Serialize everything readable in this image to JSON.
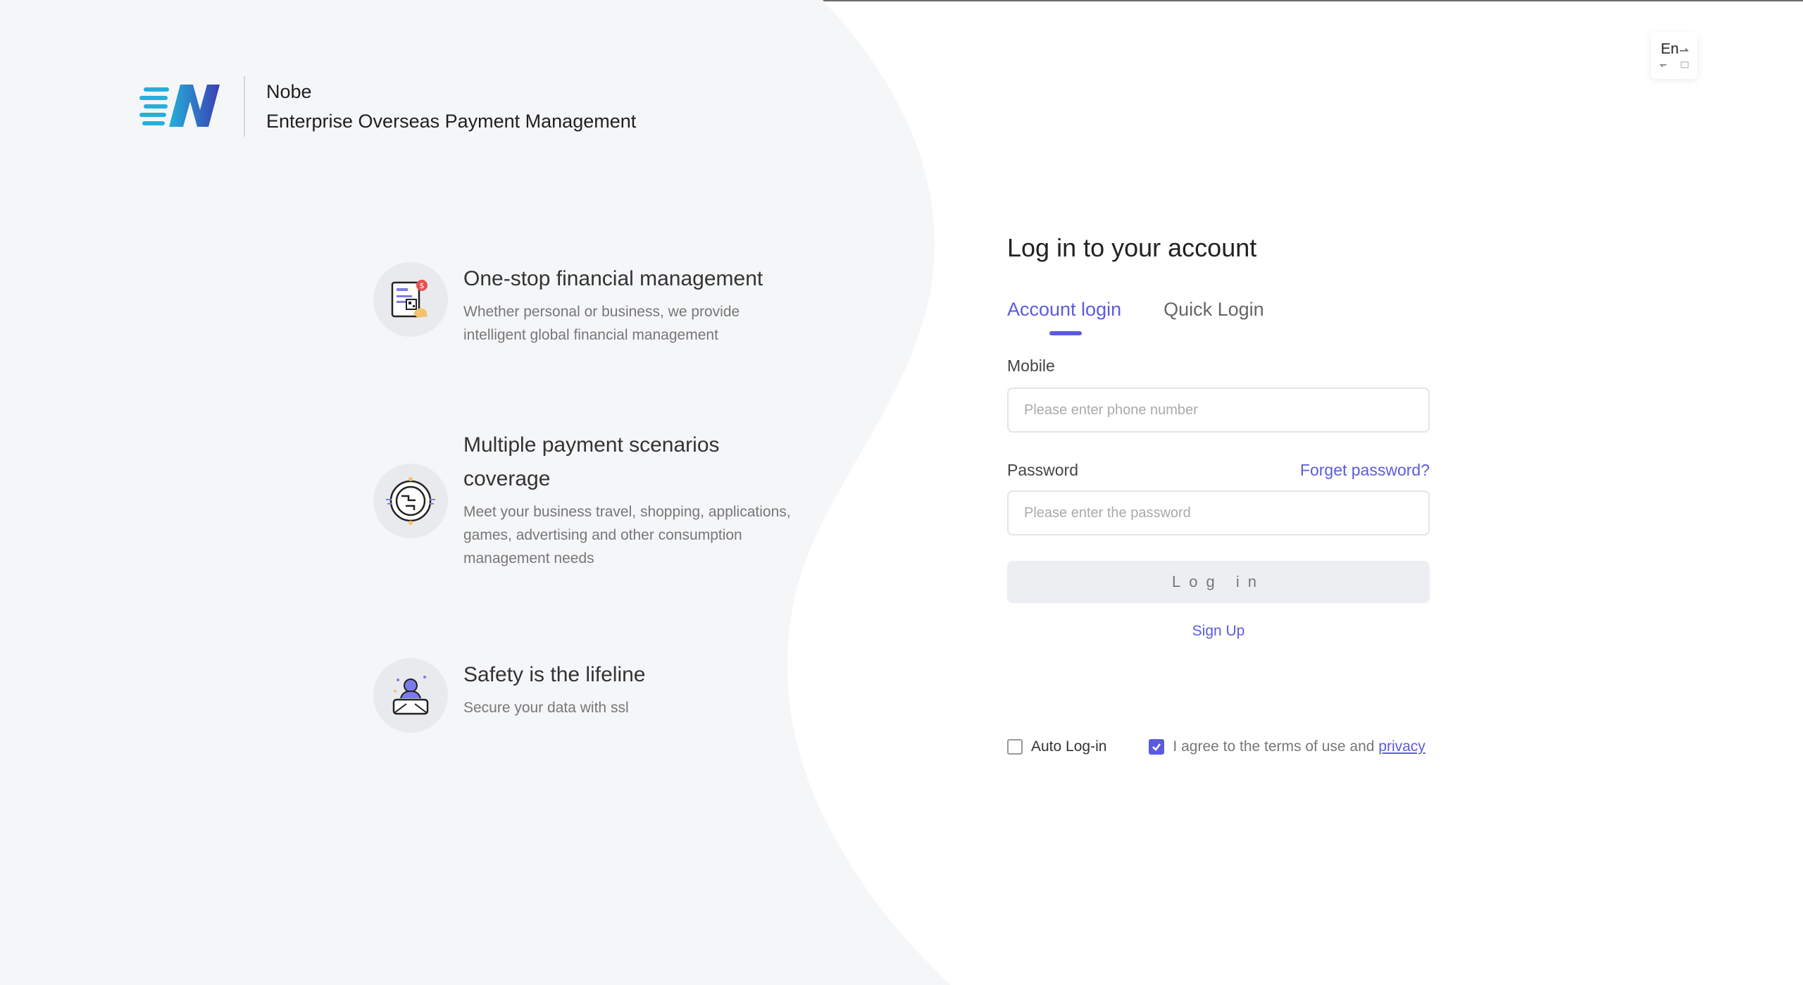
{
  "brand": {
    "name": "Nobe",
    "subtitle": "Enterprise Overseas Payment Management"
  },
  "features": [
    {
      "title": "One-stop financial management",
      "desc": "Whether personal or business, we provide intelligent global financial management"
    },
    {
      "title": "Multiple payment scenarios coverage",
      "desc": "Meet your business travel, shopping, applications, games, advertising and other consumption management needs"
    },
    {
      "title": "Safety is the lifeline",
      "desc": "Secure your data with ssl"
    }
  ],
  "lang": {
    "label": "En"
  },
  "login": {
    "title": "Log in to your account",
    "tabs": [
      {
        "label": "Account login",
        "active": true
      },
      {
        "label": "Quick Login",
        "active": false
      }
    ],
    "mobile_label": "Mobile",
    "mobile_placeholder": "Please enter phone number",
    "password_label": "Password",
    "forget_label": "Forget password?",
    "password_placeholder": "Please enter the password",
    "login_button": "Log in",
    "signup_label": "Sign Up"
  },
  "agree": {
    "auto_login_label": "Auto Log-in",
    "auto_login_checked": false,
    "terms_prefix": "I agree to the terms of use and",
    "privacy_label": "privacy",
    "terms_checked": true
  },
  "colors": {
    "accent": "#5b5bdf",
    "left_bg": "#f5f6f8"
  }
}
